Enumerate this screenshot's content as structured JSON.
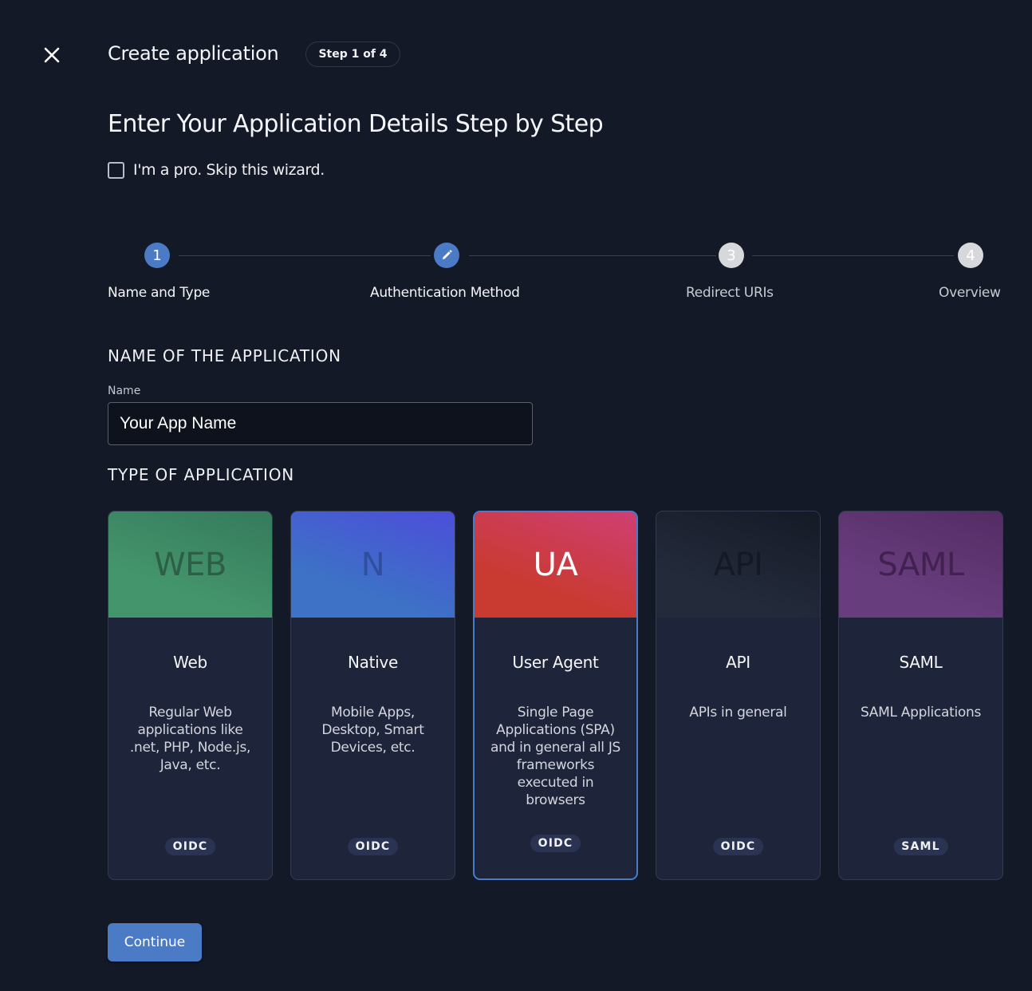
{
  "header": {
    "title": "Create application",
    "step_badge": "Step 1 of 4",
    "close_icon": "close-icon"
  },
  "intro": {
    "heading": "Enter Your Application Details Step by Step",
    "skip_label": "I'm a pro. Skip this wizard.",
    "skip_checked": false
  },
  "stepper": {
    "steps": [
      {
        "indicator": "1",
        "label": "Name and Type",
        "state": "active"
      },
      {
        "indicator": "pencil-icon",
        "label": "Authentication Method",
        "state": "active"
      },
      {
        "indicator": "3",
        "label": "Redirect URIs",
        "state": "inactive"
      },
      {
        "indicator": "4",
        "label": "Overview",
        "state": "inactive"
      }
    ]
  },
  "name_section": {
    "title": "NAME OF THE APPLICATION",
    "field_label": "Name",
    "value": "Your App Name",
    "placeholder": ""
  },
  "type_section": {
    "title": "TYPE OF APPLICATION",
    "selected": "User Agent",
    "cards": [
      {
        "badge": "WEB",
        "title": "Web",
        "description": "Regular Web applications like .net, PHP, Node.js, Java, etc.",
        "tag": "OIDC",
        "gradient": [
          "#44956c",
          "#357a5c"
        ],
        "badge_color": "#2c5f45"
      },
      {
        "badge": "N",
        "title": "Native",
        "description": "Mobile Apps, Desktop, Smart Devices, etc.",
        "tag": "OIDC",
        "gradient": [
          "#3d72c6",
          "#4c4ed9"
        ],
        "badge_color": "#2f4e9e"
      },
      {
        "badge": "UA",
        "title": "User Agent",
        "description": "Single Page Applications (SPA) and in general all JS frameworks executed in browsers",
        "tag": "OIDC",
        "gradient": [
          "#c93a30",
          "#cf3f73"
        ],
        "badge_color": "#ffffff"
      },
      {
        "badge": "API",
        "title": "API",
        "description": "APIs in general",
        "tag": "OIDC",
        "gradient": [
          "#232a3a",
          "#151a26"
        ],
        "badge_color": "#141925"
      },
      {
        "badge": "SAML",
        "title": "SAML",
        "description": "SAML Applications",
        "tag": "SAML",
        "gradient": [
          "#683d7e",
          "#542c63"
        ],
        "badge_color": "#40214f"
      }
    ]
  },
  "actions": {
    "continue_label": "Continue"
  },
  "colors": {
    "background": "#141927",
    "accent": "#4a7bc4",
    "card_body": "#1e253a"
  }
}
